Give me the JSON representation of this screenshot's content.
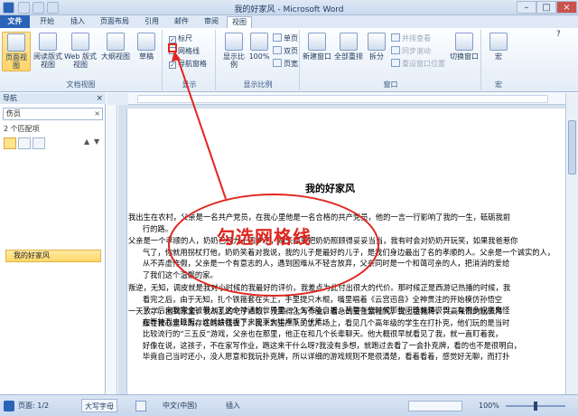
{
  "window": {
    "title": "我的好家风 - Microsoft Word"
  },
  "tabs": [
    {
      "label": "文件",
      "active": false
    },
    {
      "label": "开始",
      "active": false
    },
    {
      "label": "插入",
      "active": false
    },
    {
      "label": "页面布局",
      "active": false
    },
    {
      "label": "引用",
      "active": false
    },
    {
      "label": "邮件",
      "active": false
    },
    {
      "label": "审阅",
      "active": false
    },
    {
      "label": "视图",
      "active": true
    }
  ],
  "ribbon": {
    "doc_views": {
      "group_label": "文档视图",
      "buttons": [
        "页面视图",
        "阅读版式\n视图",
        "Web 版式视图",
        "大纲视图",
        "草稿"
      ]
    },
    "show": {
      "group_label": "显示",
      "ruler": "标尺",
      "ruler_checked": true,
      "gridlines": "网格线",
      "gridlines_checked": false,
      "nav_pane": "导航窗格",
      "nav_pane_checked": true
    },
    "zoom": {
      "group_label": "显示比例",
      "zoom_btn": "显示比例",
      "hundred": "100%",
      "one_page": "单页",
      "two_pages": "双页",
      "page_width": "页宽"
    },
    "window": {
      "group_label": "窗口",
      "new_window": "新建窗口",
      "arrange_all": "全部重排",
      "split": "拆分",
      "side_by_side": "并排查看",
      "sync_scroll": "同步滚动",
      "reset_pos": "重设窗口位置",
      "switch_windows": "切换窗口"
    },
    "macros": {
      "label": "宏",
      "group_label": "宏"
    }
  },
  "nav_pane": {
    "title": "导航",
    "search_value": "伤员",
    "match_count": "2 个匹配项",
    "heading_item": "我的好家风"
  },
  "document": {
    "title": "我的好家风",
    "paragraphs": [
      "我出生在农村，父亲是一名共产党员，在我心里他是一名合格的共产党员，他的一言一行影响了我的一生，砥砺我前\n      行的路。",
      "父亲是一个孝顺的人，奶奶已经九十四岁了，每天都要把奶奶照顾得妥妥当当，我有时会对奶奶开玩笑，如果我爸惹你\n      气了，你就用拐杖打他，奶奶笑着对我说，我的儿子是最好的儿子，是我们身边最出了名的孝顺的人。父亲是一个诚实的人，\n      从不弄虚作假，父亲是一个有意志的人，遇到困难从不轻言放弃，父亲同时是一个和蔼可亲的人，把消消的爱给\n      了我们这个温馨的家。",
      "叛逆，无知，调皮就是我对小时候的我最好的评价。我差点为此付出很大的代价。那时候正是西游记热播的时候，我\n      看完之后，由于无知，扎个铁箍套在头上，手里提只木棍，嘴里唱着《云宫迅音》全神贯注的开始模仿孙悟空\n      了，后来我完全被带入了这个神话的世界里。久久不能自拔。甚至有些时候那些问题就是很哥，有很多奴魔鬼怪\n      在等待我去降服。这就给我埋下来犯下大错埋下了伏笔。",
      "一天放学，回到家里，我胡乱的吃了点饭，没顾得上写作业，看急的要上紧箍咒，提上金箍棒，兴高采烈的出去降\n      服在我心里以为存在的妖怪去了，我来到生产队的土广场上，看见几个高年级的学生在打扑克，他们玩的是当时\n      比较流行的“三五反”游戏，父亲也在那里，他正在和几个长辈聊天。他大概很早就看见了我，就一直盯着我，\n      好像在说，这孩子，不在家写作业，跑这来干什么呀?我没有多想，就跑过去看了一会扑克牌，看的也不是很明白，\n      毕竟自己当时还小，没人愿意和我玩扑克牌，所以详细的游戏规则不是很清楚，看着看着，感觉好无聊，而打扑"
    ]
  },
  "annotation": {
    "text": "勾选网格线"
  },
  "status_bar": {
    "page": "页面: 1/2",
    "caps": "大写字母",
    "language": "中文(中国)",
    "insert": "插入",
    "zoom": "100%",
    "zoom_level": 1.0
  }
}
